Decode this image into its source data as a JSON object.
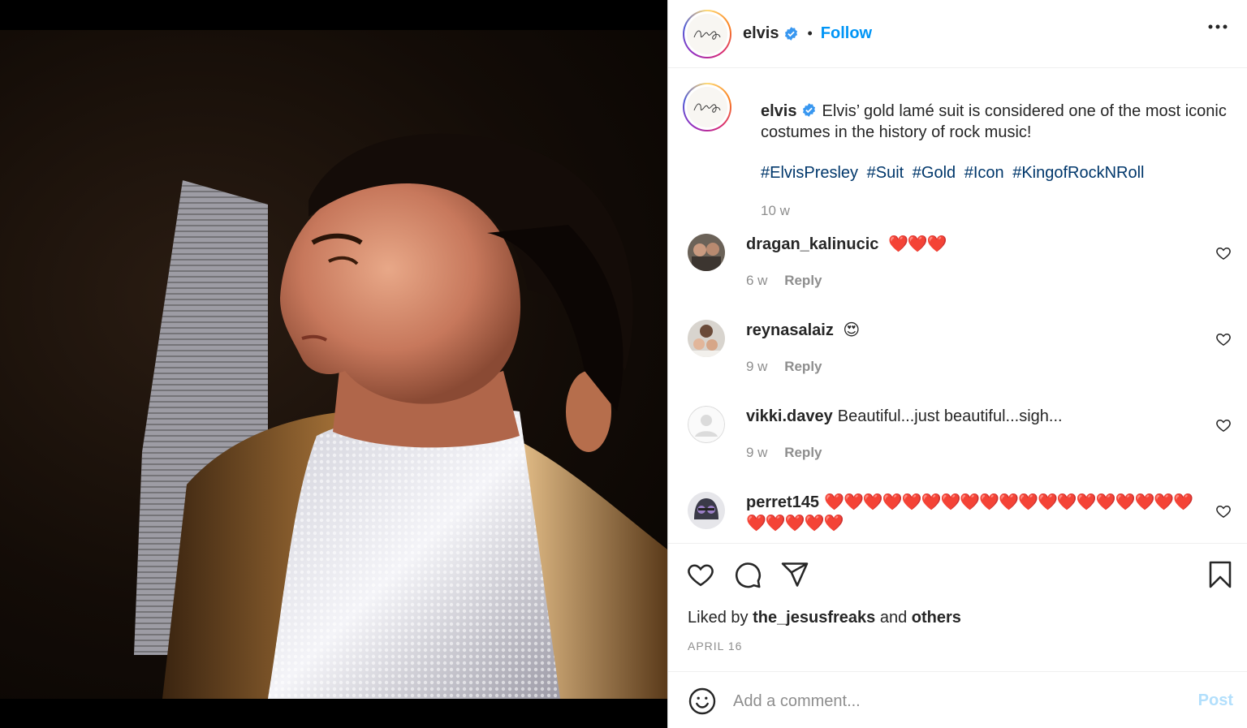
{
  "post": {
    "username": "elvis",
    "follow_label": "Follow",
    "separator": "•",
    "photo_icon": "photo-portrait"
  },
  "caption": {
    "username": "elvis",
    "text": "Elvis’ gold lamé suit is considered one of the most iconic costumes in the history of rock music!",
    "hashtags": [
      "#ElvisPresley",
      "#Suit",
      "#Gold",
      "#Icon",
      "#KingofRockNRoll"
    ],
    "age": "10 w"
  },
  "comments": [
    {
      "username": "dragan_kalinucic",
      "text": "❤️❤️❤️",
      "age": "6 w",
      "reply_label": "Reply"
    },
    {
      "username": "reynasalaiz",
      "text": "😍",
      "age": "9 w",
      "reply_label": "Reply"
    },
    {
      "username": "vikki.davey",
      "text": "Beautiful...just beautiful...sigh...",
      "age": "9 w",
      "reply_label": "Reply"
    },
    {
      "username": "perret145",
      "text": "❤️❤️❤️❤️❤️❤️❤️❤️❤️❤️❤️❤️❤️❤️❤️❤️❤️❤️❤️❤️❤️❤️❤️❤️"
    }
  ],
  "likes": {
    "prefix": "Liked by",
    "user": "the_jesusfreaks",
    "conjunction": "and",
    "others": "others"
  },
  "date": "APRIL 16",
  "comment_box": {
    "placeholder": "Add a comment...",
    "post_label": "Post"
  },
  "colors": {
    "accent": "#0095f6",
    "hashtag": "#00376b",
    "muted": "#8e8e8e",
    "heart": "#e0245e",
    "post_disabled": "#b2dffc"
  },
  "icons": [
    "verified-badge-icon",
    "more-options-icon",
    "heart-outline-icon",
    "comment-bubble-icon",
    "share-paper-plane-icon",
    "bookmark-icon",
    "emoji-smile-icon"
  ]
}
